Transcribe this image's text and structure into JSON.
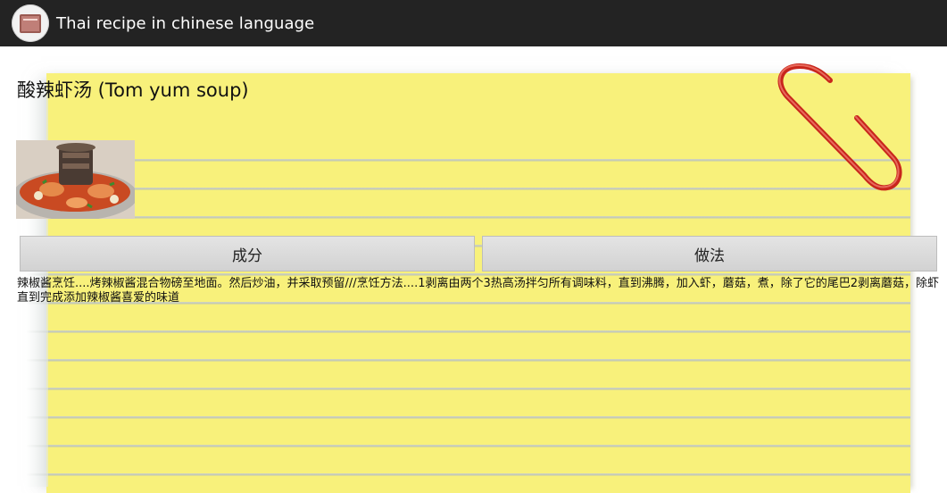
{
  "app_bar": {
    "title": "Thai recipe in chinese language",
    "icon": "recipe-book-icon"
  },
  "recipe": {
    "title": "酸辣虾汤 (Tom yum soup)",
    "photo": "tom-yum-soup-photo",
    "text": "辣椒酱烹饪....烤辣椒酱混合物磅至地面。然后炒油，并采取预留///烹饪方法....1剥离由两个3热高汤拌匀所有调味料，直到沸腾，加入虾，蘑菇，煮，除了它的尾巴2剥离蘑菇，除虾直到完成添加辣椒酱喜爱的味道"
  },
  "tabs": {
    "ingredients_label": "成分",
    "method_label": "做法"
  },
  "colors": {
    "app_bar": "#232323",
    "notepad": "#f8f17b",
    "paperclip": "#c8261c"
  }
}
